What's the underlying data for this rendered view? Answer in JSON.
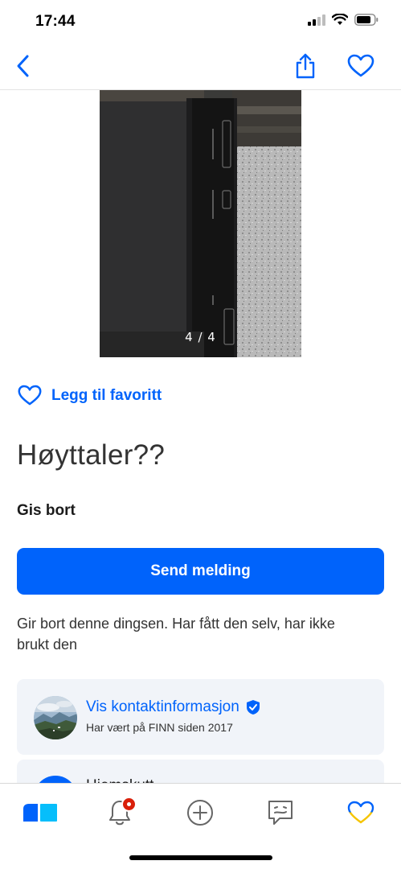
{
  "status_bar": {
    "time": "17:44"
  },
  "nav": {
    "back_icon": "chevron-left-icon",
    "share_icon": "share-icon",
    "favorite_icon": "heart-icon"
  },
  "photo": {
    "counter": "4 / 4"
  },
  "favorite": {
    "label": "Legg til favoritt"
  },
  "ad": {
    "title": "Høyttaler??",
    "price": "Gis bort",
    "send_label": "Send melding",
    "description": "Gir bort denne dingsen. Har fått den selv, har ikke brukt den"
  },
  "seller": {
    "contact_label": "Vis kontaktinformasjon",
    "member_since": "Har vært på FINN siden 2017",
    "next_card_text": "Hjemskutt"
  },
  "tabs": [
    {
      "name": "home",
      "icon": "finn-logo-icon"
    },
    {
      "name": "notifications",
      "icon": "bell-icon"
    },
    {
      "name": "new-ad",
      "icon": "plus-circle-icon"
    },
    {
      "name": "messages",
      "icon": "chat-icon"
    },
    {
      "name": "favorites",
      "icon": "heart-icon"
    }
  ],
  "colors": {
    "accent": "#0063fb",
    "badge": "#d91f0a",
    "card_bg": "#f1f4f9",
    "favorite_tab_yellow": "#f5c400"
  }
}
